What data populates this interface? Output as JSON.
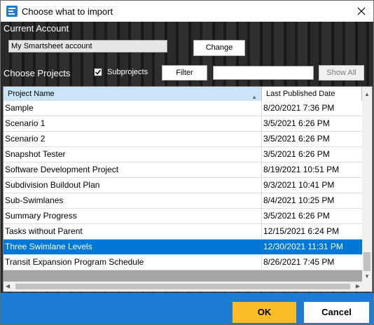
{
  "window": {
    "title": "Choose what to import"
  },
  "account": {
    "section_label": "Current Account",
    "value": "My Smartsheet account",
    "change_label": "Change"
  },
  "projects": {
    "section_label": "Choose Projects",
    "subprojects_label": "Subprojects",
    "subprojects_checked": true,
    "filter_label": "Filter",
    "filter_value": "",
    "show_all_label": "Show All"
  },
  "table": {
    "columns": [
      "Project Name",
      "Last Published Date"
    ],
    "rows": [
      {
        "name": "Sample",
        "date": "8/20/2021 7:36 PM"
      },
      {
        "name": "Scenario 1",
        "date": "3/5/2021 6:26 PM"
      },
      {
        "name": "Scenario 2",
        "date": "3/5/2021 6:26 PM"
      },
      {
        "name": "Snapshot Tester",
        "date": "3/5/2021 6:26 PM"
      },
      {
        "name": "Software Development Project",
        "date": "8/19/2021 10:51 PM"
      },
      {
        "name": "Subdivision Buildout Plan",
        "date": "9/3/2021 10:41 PM"
      },
      {
        "name": "Sub-Swimlanes",
        "date": "8/4/2021 10:25 PM"
      },
      {
        "name": "Summary Progress",
        "date": "3/5/2021 6:26 PM"
      },
      {
        "name": "Tasks without Parent",
        "date": "12/15/2021 6:24 PM"
      },
      {
        "name": "Three Swimlane Levels",
        "date": "12/30/2021 11:31 PM",
        "selected": true
      },
      {
        "name": "Transit Expansion Program Schedule",
        "date": "8/26/2021 7:45 PM"
      }
    ]
  },
  "footer": {
    "ok_label": "OK",
    "cancel_label": "Cancel"
  },
  "colors": {
    "accent": "#1d7bd4",
    "ok": "#fbbd25",
    "selected_row": "#0078d7"
  },
  "icons": {
    "app": "app-icon",
    "close": "close-icon",
    "check": "checkmark-icon"
  }
}
